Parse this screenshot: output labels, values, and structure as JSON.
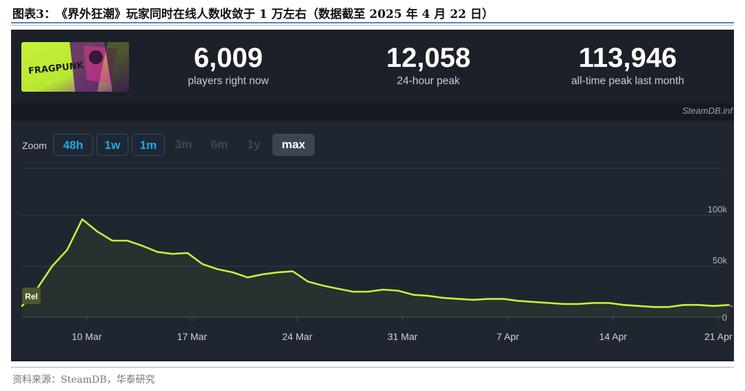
{
  "figure_title": "图表3：　《界外狂潮》玩家同时在线人数收敛于 1 万左右（数据截至 2025 年 4 月 22 日）",
  "stats": [
    {
      "value": "6,009",
      "label": "players right now"
    },
    {
      "value": "12,058",
      "label": "24-hour peak"
    },
    {
      "value": "113,946",
      "label": "all-time peak last month"
    }
  ],
  "watermark": "SteamDB.inf",
  "game_image_label": "FRAGPUNK",
  "zoom": {
    "label": "Zoom",
    "buttons": [
      {
        "label": "48h",
        "state": "active"
      },
      {
        "label": "1w",
        "state": "active"
      },
      {
        "label": "1m",
        "state": "active"
      },
      {
        "label": "3m",
        "state": "disabled"
      },
      {
        "label": "6m",
        "state": "disabled"
      },
      {
        "label": "1y",
        "state": "disabled"
      },
      {
        "label": "max",
        "state": "selected"
      }
    ]
  },
  "release_marker": "Rel",
  "source": "资料来源：SteamDB，华泰研究",
  "colors": {
    "line": "#c8f03a",
    "panel_bg": "#1b2029",
    "chart_bg": "#202630",
    "zoom_active": "#1fa8e8"
  },
  "chart_data": {
    "type": "line",
    "title": "",
    "xlabel": "",
    "ylabel": "",
    "ylim": [
      0,
      120000
    ],
    "y_ticks": [
      0,
      50000,
      100000
    ],
    "y_tick_labels": [
      "0",
      "50k",
      "100k"
    ],
    "x_tick_labels": [
      "10 Mar",
      "17 Mar",
      "24 Mar",
      "31 Mar",
      "7 Apr",
      "14 Apr",
      "21 Apr"
    ],
    "x_tick_days": [
      10,
      17,
      24,
      31,
      38,
      45,
      52
    ],
    "grid": true,
    "legend": "none",
    "series": [
      {
        "x_days": [
          5.7,
          6.7,
          7.7,
          8.7,
          9.7,
          10.7,
          11.7,
          12.7,
          13.7,
          14.7,
          15.7,
          16.7,
          17.7,
          18.7,
          19.7,
          20.7,
          21.7,
          22.7,
          23.7,
          24.7,
          25.7,
          26.7,
          27.7,
          28.7,
          29.7,
          30.7,
          31.7,
          32.7,
          33.7,
          34.7,
          35.7,
          36.7,
          37.7,
          38.7,
          39.7,
          40.7,
          41.7,
          42.7,
          43.7,
          44.7,
          45.7,
          46.7,
          47.7,
          48.7,
          49.7,
          50.7,
          51.7,
          52.7
        ],
        "values": [
          11000,
          28000,
          50000,
          66000,
          96000,
          84000,
          75000,
          75000,
          70000,
          64000,
          62000,
          63000,
          52000,
          47000,
          44000,
          39000,
          42000,
          44000,
          45000,
          35000,
          31000,
          28000,
          25000,
          25000,
          27000,
          26000,
          22000,
          21000,
          19000,
          18000,
          17000,
          18000,
          18000,
          16000,
          15000,
          14000,
          13000,
          13000,
          14000,
          14000,
          12000,
          11000,
          10000,
          10000,
          12000,
          12000,
          11000,
          12000
        ]
      }
    ]
  }
}
